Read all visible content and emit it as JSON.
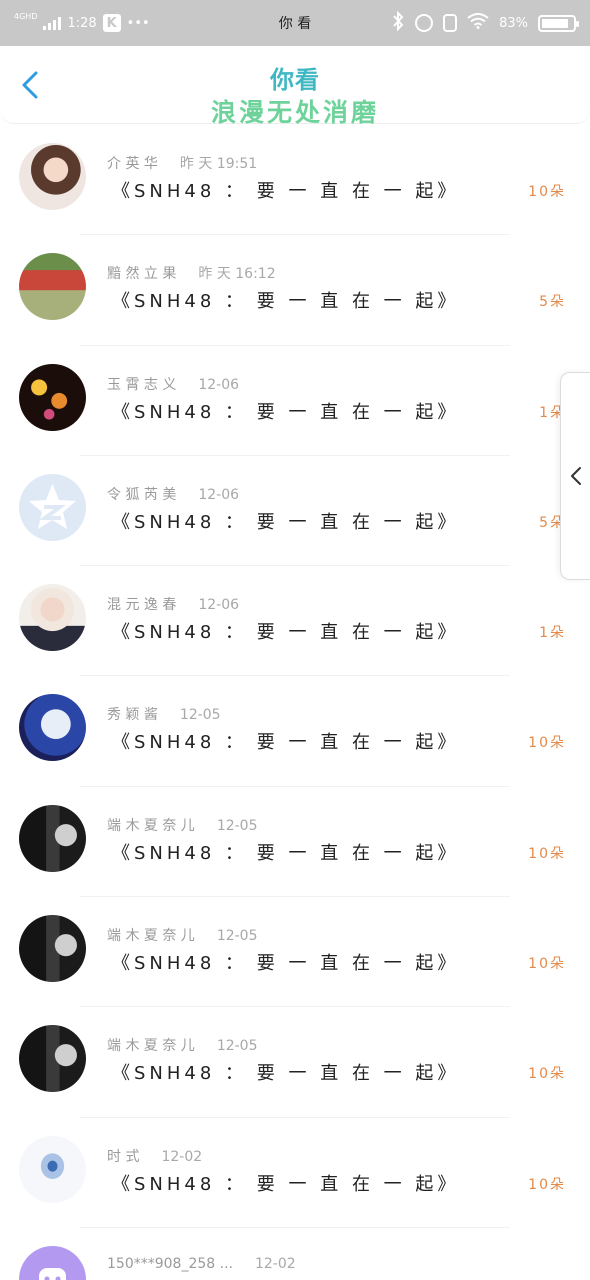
{
  "status_bar": {
    "network": "4GHD",
    "time": "1:28",
    "app_badge": "K",
    "dots": "•••",
    "center_text": "你 看",
    "battery": "83%"
  },
  "header": {
    "title": "你看",
    "subtitle": "浪漫无处消磨"
  },
  "icons": {
    "back": "chevron-left-icon",
    "side": "chevron-left-icon"
  },
  "colors": {
    "title": "#3fb8c4",
    "subtitle": "#6ed39a",
    "count": "#e38a4a",
    "back": "#2f9be0"
  },
  "records": [
    {
      "name": "介 英 华",
      "time": "昨 天  19:51",
      "gift": "《SNH48 ： 要 一 直 在 一 起》",
      "count": "10朵",
      "avatar": "girl-portrait"
    },
    {
      "name": "黯 然 立 果",
      "time": "昨 天  16:12",
      "gift": "《SNH48 ： 要 一 直 在 一 起》",
      "count": "5朵",
      "avatar": "two-girls-photo"
    },
    {
      "name": "玉 霄 志 义",
      "time": "12-06",
      "gift": "《SNH48 ： 要 一 直 在 一 起》",
      "count": "1朵",
      "avatar": "bokeh-lights"
    },
    {
      "name": "令 狐 芮 美",
      "time": "12-06",
      "gift": "《SNH48 ： 要 一 直 在 一 起》",
      "count": "5朵",
      "avatar": "qzone-default"
    },
    {
      "name": "混 元 逸 春",
      "time": "12-06",
      "gift": "《SNH48 ： 要 一 直 在 一 起》",
      "count": "1朵",
      "avatar": "blond-boy"
    },
    {
      "name": "秀 颖 酱",
      "time": "12-05",
      "gift": "《SNH48 ： 要 一 直 在 一 起》",
      "count": "10朵",
      "avatar": "anime-boy"
    },
    {
      "name": "端 木 夏 奈 儿",
      "time": "12-05",
      "gift": "《SNH48 ： 要 一 直 在 一 起》",
      "count": "10朵",
      "avatar": "dark-selfie"
    },
    {
      "name": "端 木 夏 奈 儿",
      "time": "12-05",
      "gift": "《SNH48 ： 要 一 直 在 一 起》",
      "count": "10朵",
      "avatar": "dark-selfie"
    },
    {
      "name": "端 木 夏 奈 儿",
      "time": "12-05",
      "gift": "《SNH48 ： 要 一 直 在 一 起》",
      "count": "10朵",
      "avatar": "dark-selfie"
    },
    {
      "name": "时 式",
      "time": "12-02",
      "gift": "《SNH48 ： 要 一 直 在 一 起》",
      "count": "10朵",
      "avatar": "blue-eye"
    },
    {
      "name": "150***908_258 ...",
      "time": "12-02",
      "gift": "",
      "count": "",
      "avatar": "purple-default"
    }
  ]
}
